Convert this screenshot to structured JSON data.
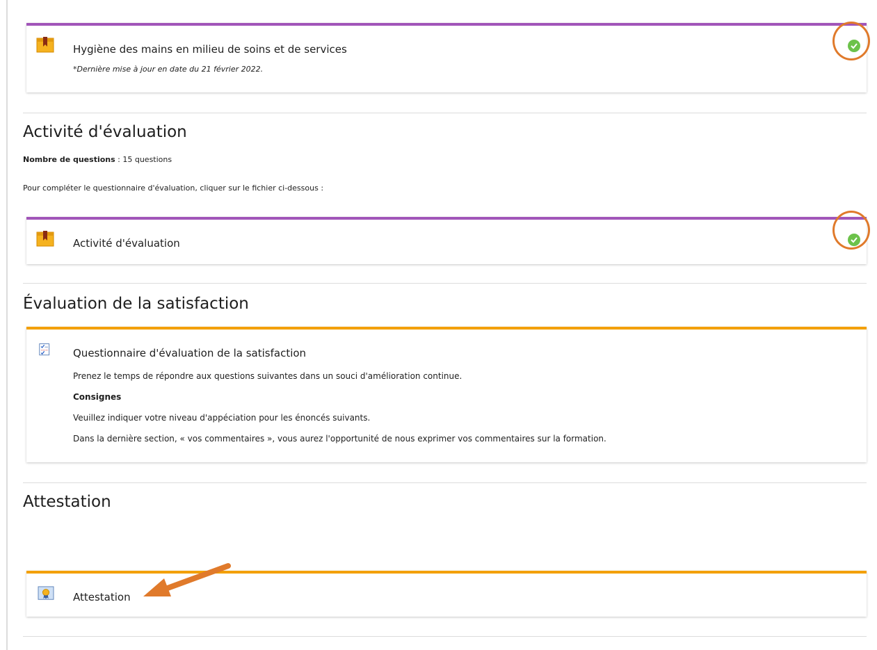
{
  "module": {
    "title": "Hygiène des mains en milieu de soins et de services",
    "note": "*Dernière mise à jour en date du 21 février 2022.",
    "icon": "package-icon",
    "status": "completed"
  },
  "evaluation_section": {
    "heading": "Activité d'évaluation",
    "questions_label": "Nombre de questions",
    "questions_value": " : 15 questions",
    "instruction": "Pour compléter le questionnaire d'évaluation, cliquer sur le fichier ci-dessous :",
    "activity": {
      "title": "Activité d'évaluation",
      "icon": "package-icon",
      "status": "completed"
    }
  },
  "satisfaction_section": {
    "heading": "Évaluation de la satisfaction",
    "activity": {
      "title": "Questionnaire d'évaluation de la satisfaction",
      "icon": "questionnaire-icon",
      "intro": "Prenez le temps de répondre aux questions suivantes dans un souci d'amélioration continue.",
      "instructions_heading": "Consignes",
      "instruction_1": "Veuillez indiquer votre niveau d'appéciation pour les énoncés suivants.",
      "instruction_2": "Dans la dernière section, « vos commentaires », vous aurez l'opportunité de nous exprimer vos commentaires sur la formation."
    }
  },
  "attestation_section": {
    "heading": "Attestation",
    "activity": {
      "title": "Attestation",
      "icon": "certificate-icon"
    }
  },
  "colors": {
    "completed_accent": "#a155b9",
    "pending_accent": "#f3a000",
    "check": "#6cc24a",
    "annotation": "#e07a2b"
  }
}
